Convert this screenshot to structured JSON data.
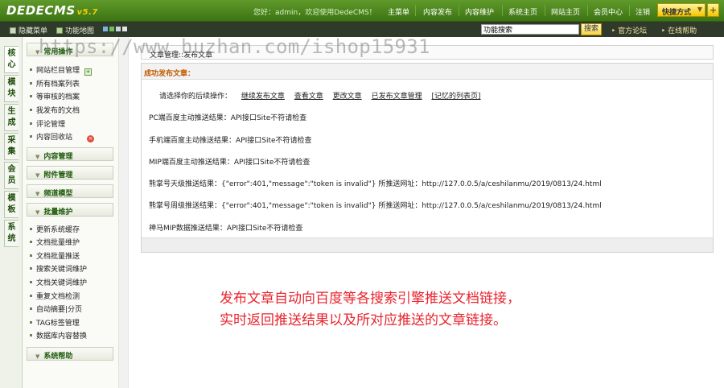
{
  "brand": {
    "logo_text": "DEDECMS",
    "version": "v5.7"
  },
  "topbar": {
    "welcome": "您好：admin，欢迎使用DedeCMS！",
    "nav": [
      "主菜单",
      "内容发布",
      "内容维护",
      "系统主页",
      "网站主页",
      "会员中心",
      "注销"
    ],
    "quick_label": "快捷方式",
    "quick_add": "+"
  },
  "subbar": {
    "hide_menu": "隐藏菜单",
    "func_map": "功能地图",
    "search_value": "功能搜索",
    "search_button": "搜索",
    "forum_link": "官方论坛",
    "help_link": "在线帮助"
  },
  "watermark": "https://www.huzhan.com/ishop15931",
  "vtabs": [
    "核心",
    "模块",
    "生成",
    "采集",
    "会员",
    "模板",
    "系统"
  ],
  "sidebar": {
    "common_group": "常用操作",
    "common_items": [
      "网站栏目管理",
      "所有档案列表",
      "等审核的档案",
      "我发布的文档",
      "评论管理",
      "内容回收站"
    ],
    "groups_collapsed": [
      "内容管理",
      "附件管理",
      "频道模型"
    ],
    "batch_group": "批量维护",
    "batch_items": [
      "更新系统缓存",
      "文档批量维护",
      "文档批量推送",
      "搜索关键词维护",
      "文档关键词维护",
      "重复文档检测",
      "自动摘要|分页",
      "TAG标签管理",
      "数据库内容替换"
    ],
    "help_group": "系统帮助"
  },
  "main": {
    "breadcrumb": "文章管理::发布文章",
    "panel_title": "成功发布文章：",
    "ops_prompt": "请选择你的后续操作：",
    "ops_links": [
      "继续发布文章",
      "查看文章",
      "更改文章",
      "已发布文章管理",
      "[记忆的列表页]"
    ],
    "results": [
      "PC端百度主动推送结果：API接口Site不符请检查",
      "手机端百度主动推送结果：API接口Site不符请检查",
      "MIP端百度主动推送结果：API接口Site不符请检查",
      "熊掌号天级推送结果：{\"error\":401,\"message\":\"token is invalid\"} 所推送网址：http://127.0.0.5/a/ceshilanmu/2019/0813/24.html",
      "熊掌号周级推送结果：{\"error\":401,\"message\":\"token is invalid\"} 所推送网址：http://127.0.0.5/a/ceshilanmu/2019/0813/24.html",
      "神马MIP数据推送结果：API接口Site不符请检查"
    ]
  },
  "annotation": {
    "line1": "发布文章自动向百度等各搜索引擎推送文档链接，",
    "line2": "实时返回推送结果以及所对应推送的文章链接。"
  },
  "colors": {
    "top_green": "#3d7414",
    "accent_orange": "#c05a00",
    "annotation_red": "#e8252e"
  }
}
